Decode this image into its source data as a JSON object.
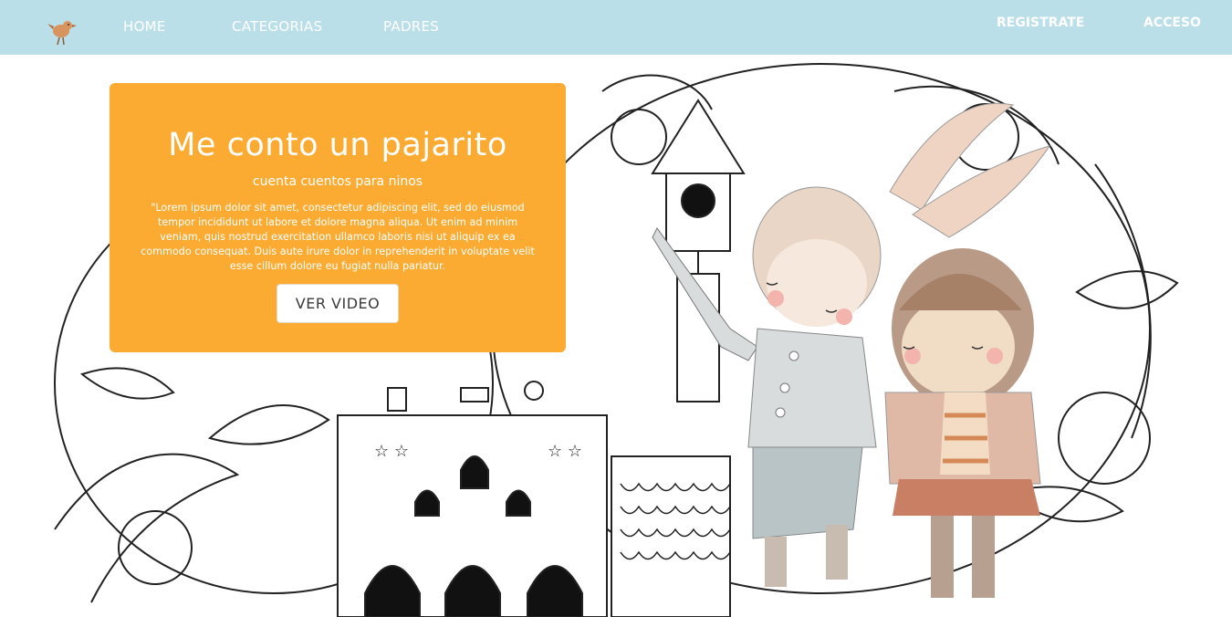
{
  "nav": {
    "logo": "bird-icon",
    "home": "HOME",
    "categorias": "CATEGORIAS",
    "padres": "PADRES",
    "registrate": "REGISTRATE",
    "acceso": "ACCESO"
  },
  "hero": {
    "title": "Me conto un pajarito",
    "subtitle": "cuenta cuentos para ninos",
    "body": "\"Lorem ipsum dolor sit amet, consectetur adipiscing elit, sed do eiusmod tempor incididunt ut labore et dolore magna aliqua. Ut enim ad minim veniam, quis nostrud exercitation ullamco laboris nisi ut aliquip ex ea commodo consequat. Duis aute irure dolor in reprehenderit in voluptate velit esse cillum dolore eu fugiat nulla pariatur.",
    "button_label": "VER VIDEO"
  },
  "colors": {
    "navbar": "#bbdfe8",
    "card": "#fbab32",
    "button_bg": "#ffffff"
  }
}
